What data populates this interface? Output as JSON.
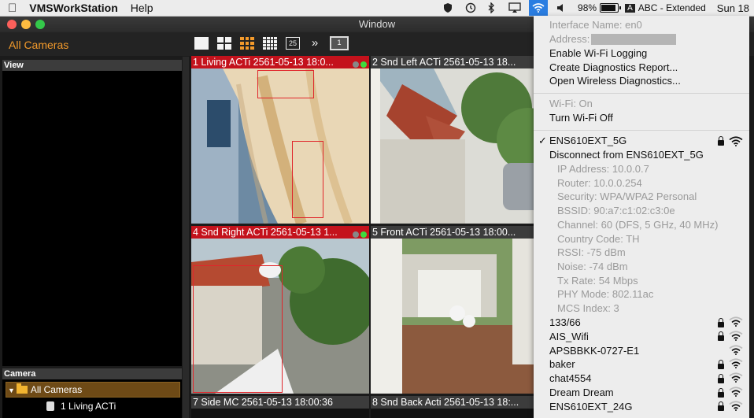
{
  "menubar": {
    "app_name": "VMSWorkStation",
    "menus": [
      "Help"
    ],
    "battery": "98%",
    "battery_level": 0.98,
    "input_badge": "A",
    "input_source": "ABC - Extended",
    "clock": "Sun 18"
  },
  "window": {
    "title": "Window"
  },
  "toolbar": {
    "group_title": "All Cameras",
    "layout_25": "25",
    "more": "»",
    "monitor": "1"
  },
  "left_panel": {
    "view_header": "View",
    "camera_header": "Camera",
    "tree": {
      "root": "All Cameras",
      "child": "1 Living ACTi"
    }
  },
  "cameras": [
    {
      "title": "1 Living ACTi 2561-05-13 18:0...",
      "alarm": true
    },
    {
      "title": "2 Snd Left ACTi 2561-05-13 18...",
      "alarm": false
    },
    {
      "title": "4 Snd Right ACTi 2561-05-13 1...",
      "alarm": true
    },
    {
      "title": "5 Front ACTi 2561-05-13 18:00...",
      "alarm": false
    },
    {
      "title": "7 Side MC 2561-05-13 18:00:36",
      "alarm": false
    },
    {
      "title": "8 Snd Back Acti 2561-05-13 18:...",
      "alarm": false
    }
  ],
  "wifi_menu": {
    "interface_name": "Interface Name: en0",
    "address_label": "Address:",
    "enable_logging": "Enable Wi-Fi Logging",
    "diagnostics_report": "Create Diagnostics Report...",
    "wireless_diagnostics": "Open Wireless Diagnostics...",
    "wifi_status": "Wi-Fi: On",
    "turn_off": "Turn Wi-Fi Off",
    "connected_check": "✓",
    "connected_network": "ENS610EXT_5G",
    "disconnect": "Disconnect from ENS610EXT_5G",
    "details": [
      "IP Address: 10.0.0.7",
      "Router: 10.0.0.254",
      "Security: WPA/WPA2 Personal",
      "BSSID: 90:a7:c1:02:c3:0e",
      "Channel: 60 (DFS, 5 GHz, 40 MHz)",
      "Country Code: TH",
      "RSSI: -75 dBm",
      "Noise: -74 dBm",
      "Tx Rate: 54 Mbps",
      "PHY Mode: 802.11ac",
      "MCS Index: 3"
    ],
    "networks": [
      {
        "name": "133/66",
        "locked": true
      },
      {
        "name": "AIS_Wifi",
        "locked": true
      },
      {
        "name": "APSBBKK-0727-E1",
        "locked": false
      },
      {
        "name": "baker",
        "locked": true
      },
      {
        "name": "chat4554",
        "locked": true
      },
      {
        "name": "Dream Dream",
        "locked": true
      },
      {
        "name": "ENS610EXT_24G",
        "locked": true
      }
    ]
  },
  "colors": {
    "accent_orange": "#f39a2b",
    "alarm_red": "#c4121c",
    "wifi_blue": "#2a7de1"
  }
}
